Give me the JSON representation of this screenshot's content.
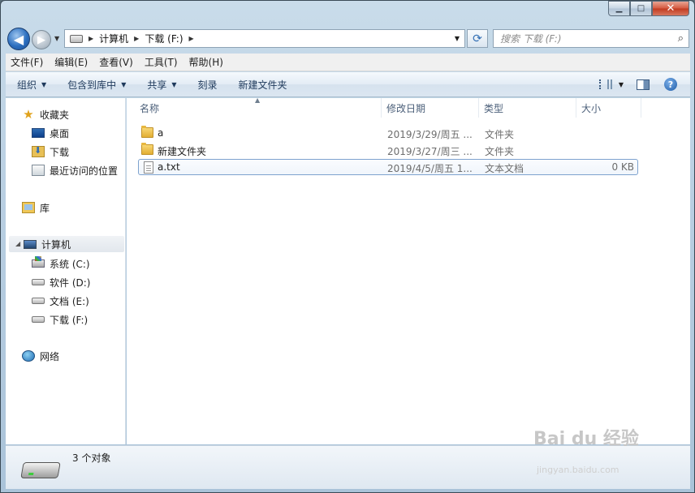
{
  "window": {
    "controls": {
      "minimize": "▁",
      "maximize": "□",
      "close": "✕"
    }
  },
  "nav": {
    "back": "◀",
    "forward": "▶",
    "breadcrumbs": [
      "计算机",
      "下载 (F:)"
    ],
    "search_placeholder": "搜索 下载 (F:)"
  },
  "menubar": [
    "文件(F)",
    "编辑(E)",
    "查看(V)",
    "工具(T)",
    "帮助(H)"
  ],
  "toolbar": {
    "organize": "组织",
    "include_library": "包含到库中",
    "share": "共享",
    "burn": "刻录",
    "new_folder": "新建文件夹",
    "help": "?"
  },
  "navpane": {
    "favorites": "收藏夹",
    "desktop": "桌面",
    "downloads": "下载",
    "recent": "最近访问的位置",
    "libraries": "库",
    "computer": "计算机",
    "drives": [
      "系统 (C:)",
      "软件 (D:)",
      "文档 (E:)",
      "下载 (F:)"
    ],
    "network": "网络"
  },
  "columns": {
    "name": "名称",
    "modified": "修改日期",
    "type": "类型",
    "size": "大小"
  },
  "files": [
    {
      "name": "a",
      "modified": "2019/3/29/周五 ...",
      "type": "文件夹",
      "size": "",
      "icon": "folder-icon"
    },
    {
      "name": "新建文件夹",
      "modified": "2019/3/27/周三 ...",
      "type": "文件夹",
      "size": "",
      "icon": "folder-icon"
    },
    {
      "name": "a.txt",
      "modified": "2019/4/5/周五 1...",
      "type": "文本文档",
      "size": "0 KB",
      "icon": "text-file-icon"
    }
  ],
  "status": {
    "count": "3 个对象"
  },
  "watermark": {
    "brand": "Bai du 经验",
    "url": "jingyan.baidu.com"
  }
}
